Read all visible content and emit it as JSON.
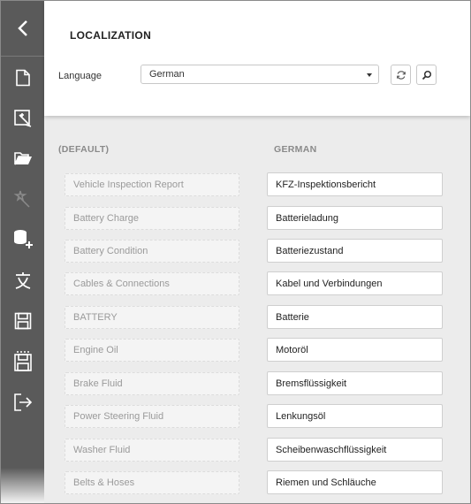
{
  "header": {
    "title": "LOCALIZATION",
    "language_label": "Language",
    "language_value": "German"
  },
  "columns": {
    "default_header": "(DEFAULT)",
    "target_header": "GERMAN"
  },
  "rows": [
    {
      "default": "Vehicle Inspection Report",
      "value": "KFZ-Inspektionsbericht"
    },
    {
      "default": "Battery Charge",
      "value": "Batterieladung"
    },
    {
      "default": "Battery Condition",
      "value": "Batteriezustand"
    },
    {
      "default": "Cables & Connections",
      "value": "Kabel und Verbindungen"
    },
    {
      "default": "BATTERY",
      "value": "Batterie"
    },
    {
      "default": "Engine Oil",
      "value": "Motoröl"
    },
    {
      "default": "Brake Fluid",
      "value": "Bremsflüssigkeit"
    },
    {
      "default": "Power Steering Fluid",
      "value": "Lenkungsöl"
    },
    {
      "default": "Washer Fluid",
      "value": "Scheibenwaschflüssigkeit"
    },
    {
      "default": "Belts & Hoses",
      "value": "Riemen und Schläuche"
    }
  ],
  "colors": {
    "sidebar_bg": "#5a5a5a",
    "content_bg": "#ececec",
    "panel_bg": "#ffffff"
  },
  "icons": {
    "sidebar": [
      "back-arrow-icon",
      "new-file-icon",
      "wizard-icon",
      "open-folder-icon",
      "magic-wand-icon",
      "add-datasource-icon",
      "localization-icon",
      "save-icon",
      "save-as-icon",
      "exit-icon"
    ],
    "header": [
      "refresh-icon",
      "search-icon"
    ]
  }
}
